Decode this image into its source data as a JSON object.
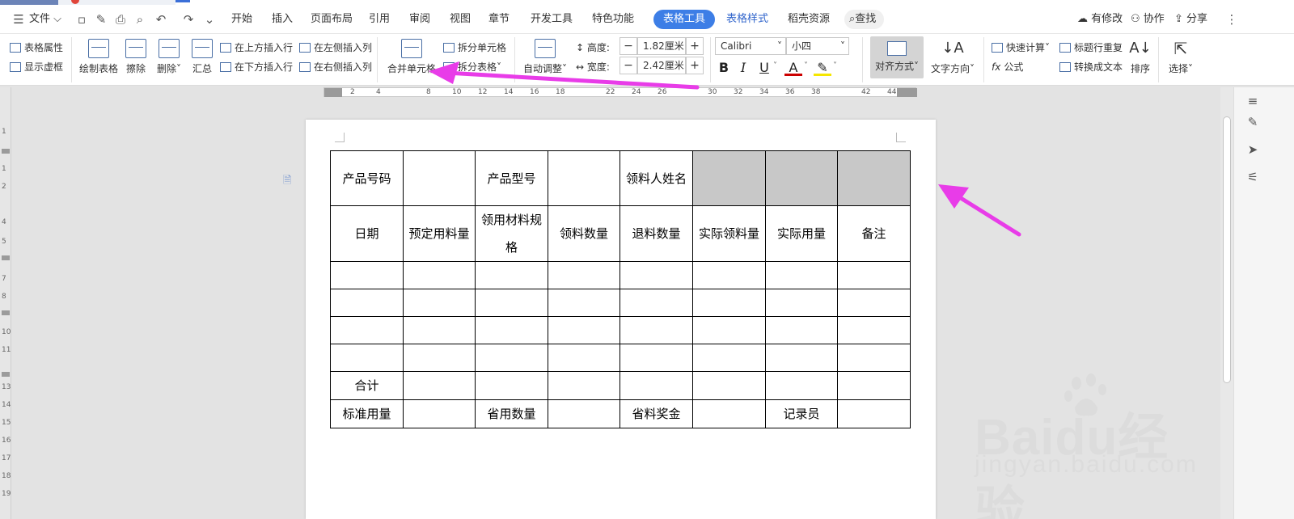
{
  "menubar": {
    "file_label": "文件",
    "tabs": [
      "开始",
      "插入",
      "页面布局",
      "引用",
      "审阅",
      "视图",
      "章节",
      "开发工具",
      "特色功能"
    ],
    "active_tab": "表格工具",
    "extra_tabs": [
      "表格样式",
      "稻壳资源"
    ],
    "search_label": "查找",
    "right": {
      "modified": "有修改",
      "collab": "协作",
      "share": "分享"
    }
  },
  "ribbon": {
    "table_props": "表格属性",
    "show_gridlines": "显示虚框",
    "draw_table": "绘制表格",
    "erase": "擦除",
    "delete": "删除",
    "summary": "汇总",
    "insert_above": "在上方插入行",
    "insert_below": "在下方插入行",
    "insert_left": "在左侧插入列",
    "insert_right": "在右侧插入列",
    "merge_cells": "合并单元格",
    "split_cells": "拆分单元格",
    "split_table": "拆分表格",
    "auto_fit": "自动调整",
    "height_label": "高度:",
    "height_value": "1.82厘米",
    "width_label": "宽度:",
    "width_value": "2.42厘米",
    "font_name": "Calibri",
    "font_size": "小四",
    "bold": "B",
    "italic": "I",
    "underline": "U",
    "font_color": "A",
    "align": "对齐方式",
    "text_direction": "文字方向",
    "quick_calc": "快速计算",
    "formula": "公式",
    "repeat_header": "标题行重复",
    "convert_text": "转换成文本",
    "sort": "排序",
    "select": "选择"
  },
  "ruler": {
    "h_ticks": [
      "2",
      "4",
      "8",
      "10",
      "12",
      "14",
      "16",
      "18",
      "22",
      "24",
      "26",
      "30",
      "32",
      "34",
      "36",
      "38",
      "42",
      "44"
    ],
    "v_ticks": [
      "1",
      "1",
      "2",
      "4",
      "5",
      "7",
      "8",
      "10",
      "11",
      "13",
      "14",
      "15",
      "16",
      "17",
      "18",
      "19"
    ]
  },
  "table": {
    "rows": [
      [
        "产品号码",
        "",
        "产品型号",
        "",
        "领料人姓名",
        "",
        "",
        ""
      ],
      [
        "日期",
        "预定用料量",
        "领用材料规格",
        "领料数量",
        "退料数量",
        "实际领料量",
        "实际用量",
        "备注"
      ],
      [
        "",
        "",
        "",
        "",
        "",
        "",
        "",
        ""
      ],
      [
        "",
        "",
        "",
        "",
        "",
        "",
        "",
        ""
      ],
      [
        "",
        "",
        "",
        "",
        "",
        "",
        "",
        ""
      ],
      [
        "",
        "",
        "",
        "",
        "",
        "",
        "",
        ""
      ],
      [
        "合计",
        "",
        "",
        "",
        "",
        "",
        "",
        ""
      ],
      [
        "标准用量",
        "",
        "省用数量",
        "",
        "省料奖金",
        "",
        "记录员",
        ""
      ]
    ]
  },
  "watermark": {
    "brand": "Baidu经验",
    "url": "jingyan.baidu.com"
  },
  "colors": {
    "accent": "#3d7ee6",
    "arrow": "#e83ce8",
    "shade": "#c8c8c8"
  }
}
